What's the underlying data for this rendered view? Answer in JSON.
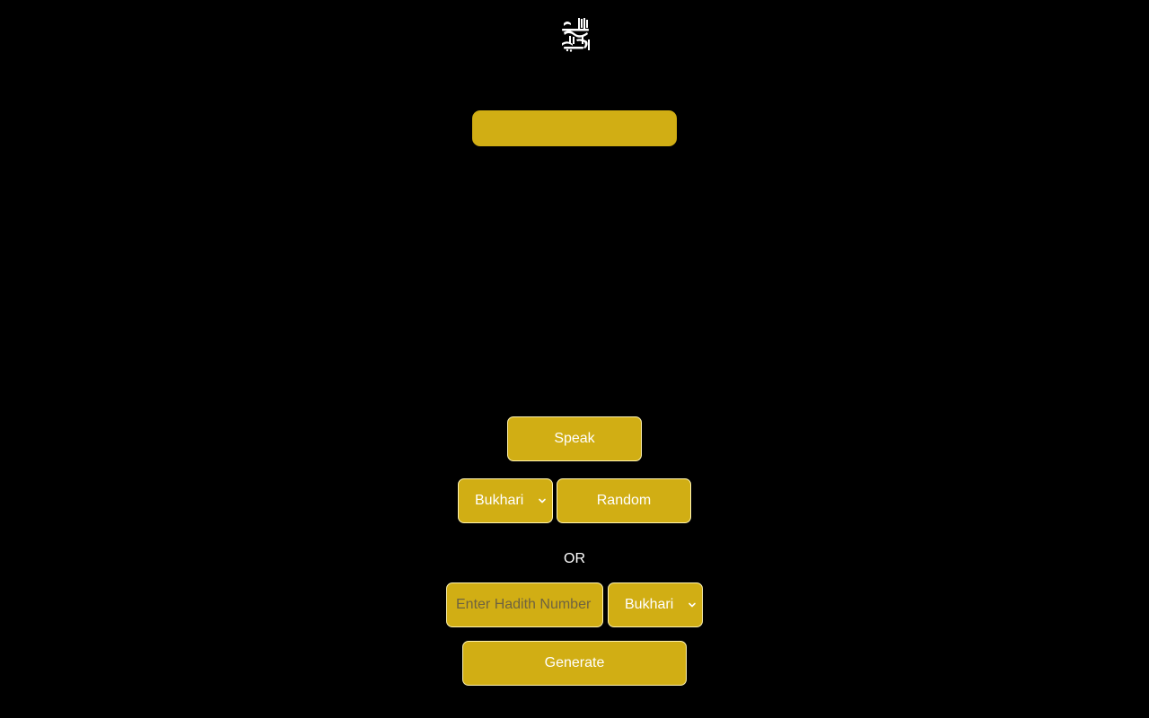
{
  "logo": {
    "icon": "bismillah-calligraphy-icon",
    "color": "#ffffff"
  },
  "display": {
    "color": "#d1ae14"
  },
  "buttons": {
    "speak_label": "Speak",
    "random_label": "Random",
    "generate_label": "Generate"
  },
  "random_section": {
    "book_selected": "Bukhari"
  },
  "divider": {
    "or_label": "OR"
  },
  "number_section": {
    "input_value": "",
    "input_placeholder": "Enter Hadith Number",
    "book_selected": "Bukhari"
  },
  "colors": {
    "background": "#000000",
    "accent": "#d1ae14",
    "text": "#ffffff"
  }
}
